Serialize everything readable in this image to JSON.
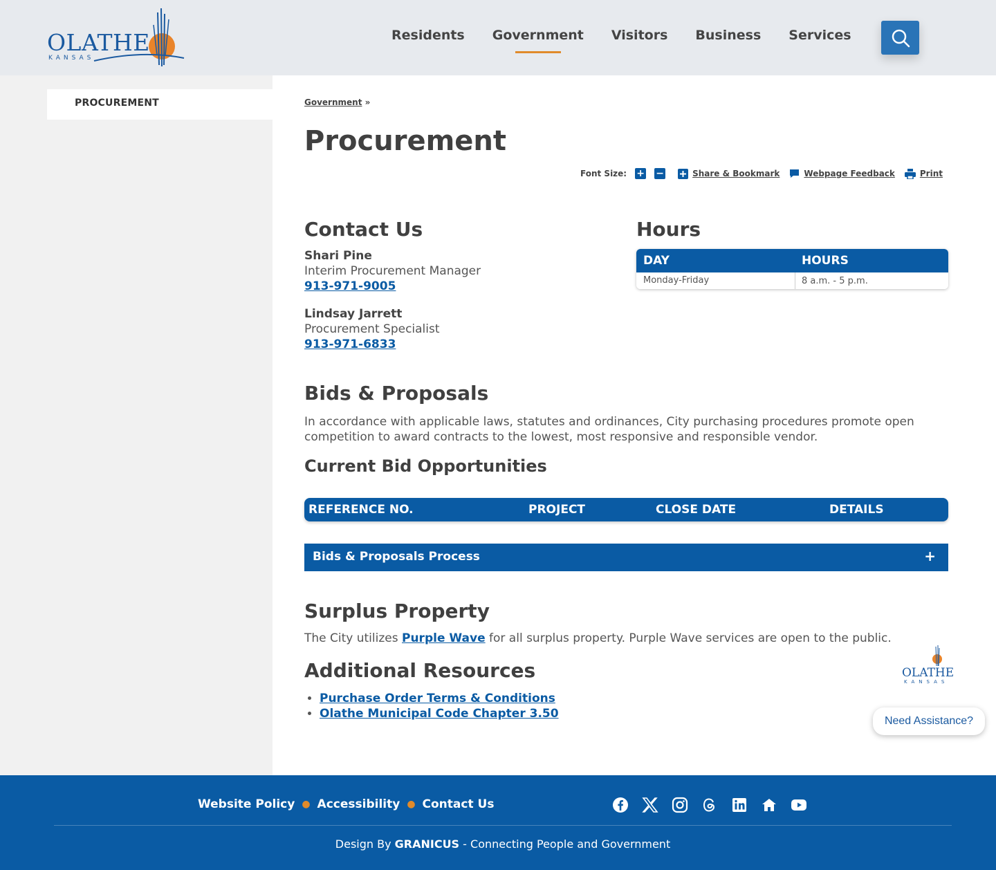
{
  "header": {
    "logo_word": "OLATHE",
    "logo_sub": "KANSAS",
    "nav": [
      "Residents",
      "Government",
      "Visitors",
      "Business",
      "Services"
    ],
    "active_nav": "Government",
    "search_icon": "search-icon"
  },
  "sidebar": {
    "items": [
      {
        "label": "PROCUREMENT"
      }
    ]
  },
  "breadcrumb": {
    "link": "Government",
    "sep": "»"
  },
  "page": {
    "title": "Procurement"
  },
  "toolbar": {
    "font_size_label": "Font Size:",
    "increase": "+",
    "decrease": "−",
    "share": "Share & Bookmark",
    "feedback": "Webpage Feedback",
    "print": "Print"
  },
  "contact": {
    "heading": "Contact Us",
    "people": [
      {
        "name": "Shari Pine",
        "role": "Interim Procurement Manager",
        "phone": "913-971-9005"
      },
      {
        "name": "Lindsay Jarrett",
        "role": "Procurement Specialist",
        "phone": "913-971-6833"
      }
    ]
  },
  "hours": {
    "heading": "Hours",
    "columns": [
      "DAY",
      "HOURS"
    ],
    "rows": [
      [
        "Monday-Friday",
        "8 a.m. - 5 p.m."
      ]
    ]
  },
  "bids": {
    "heading": "Bids & Proposals",
    "intro": "In accordance with applicable laws, statutes and ordinances, City purchasing procedures promote open competition to award contracts to the lowest, most responsive and responsible vendor.",
    "current_heading": "Current Bid Opportunities",
    "columns": [
      "REFERENCE NO.",
      "PROJECT",
      "CLOSE DATE",
      "DETAILS"
    ],
    "accordion_label": "Bids & Proposals Process",
    "accordion_toggle": "+"
  },
  "surplus": {
    "heading": "Surplus Property",
    "text_before": "The City utilizes ",
    "link": "Purple Wave",
    "text_after": " for all surplus property. Purple Wave services are open to the public."
  },
  "resources": {
    "heading": "Additional Resources",
    "links": [
      "Purchase Order Terms & Conditions",
      "Olathe Municipal Code Chapter 3.50"
    ]
  },
  "widgets": {
    "small_logo_word": "OLATHE",
    "small_logo_sub": "KANSAS",
    "assist": "Need Assistance?"
  },
  "footer": {
    "links": [
      "Website Policy",
      "Accessibility",
      "Contact Us"
    ],
    "socials": [
      "facebook-icon",
      "x-icon",
      "instagram-icon",
      "threads-icon",
      "linkedin-icon",
      "nextdoor-icon",
      "youtube-icon"
    ],
    "credit_prefix": "Design By ",
    "credit_brand": "GRANICUS",
    "credit_suffix": " - Connecting People and Government"
  },
  "colors": {
    "brand_blue": "#0a5ba4",
    "accent_orange": "#e08a2a",
    "header_bg": "#e7eaee",
    "sidebar_bg": "#f1f1f1"
  }
}
